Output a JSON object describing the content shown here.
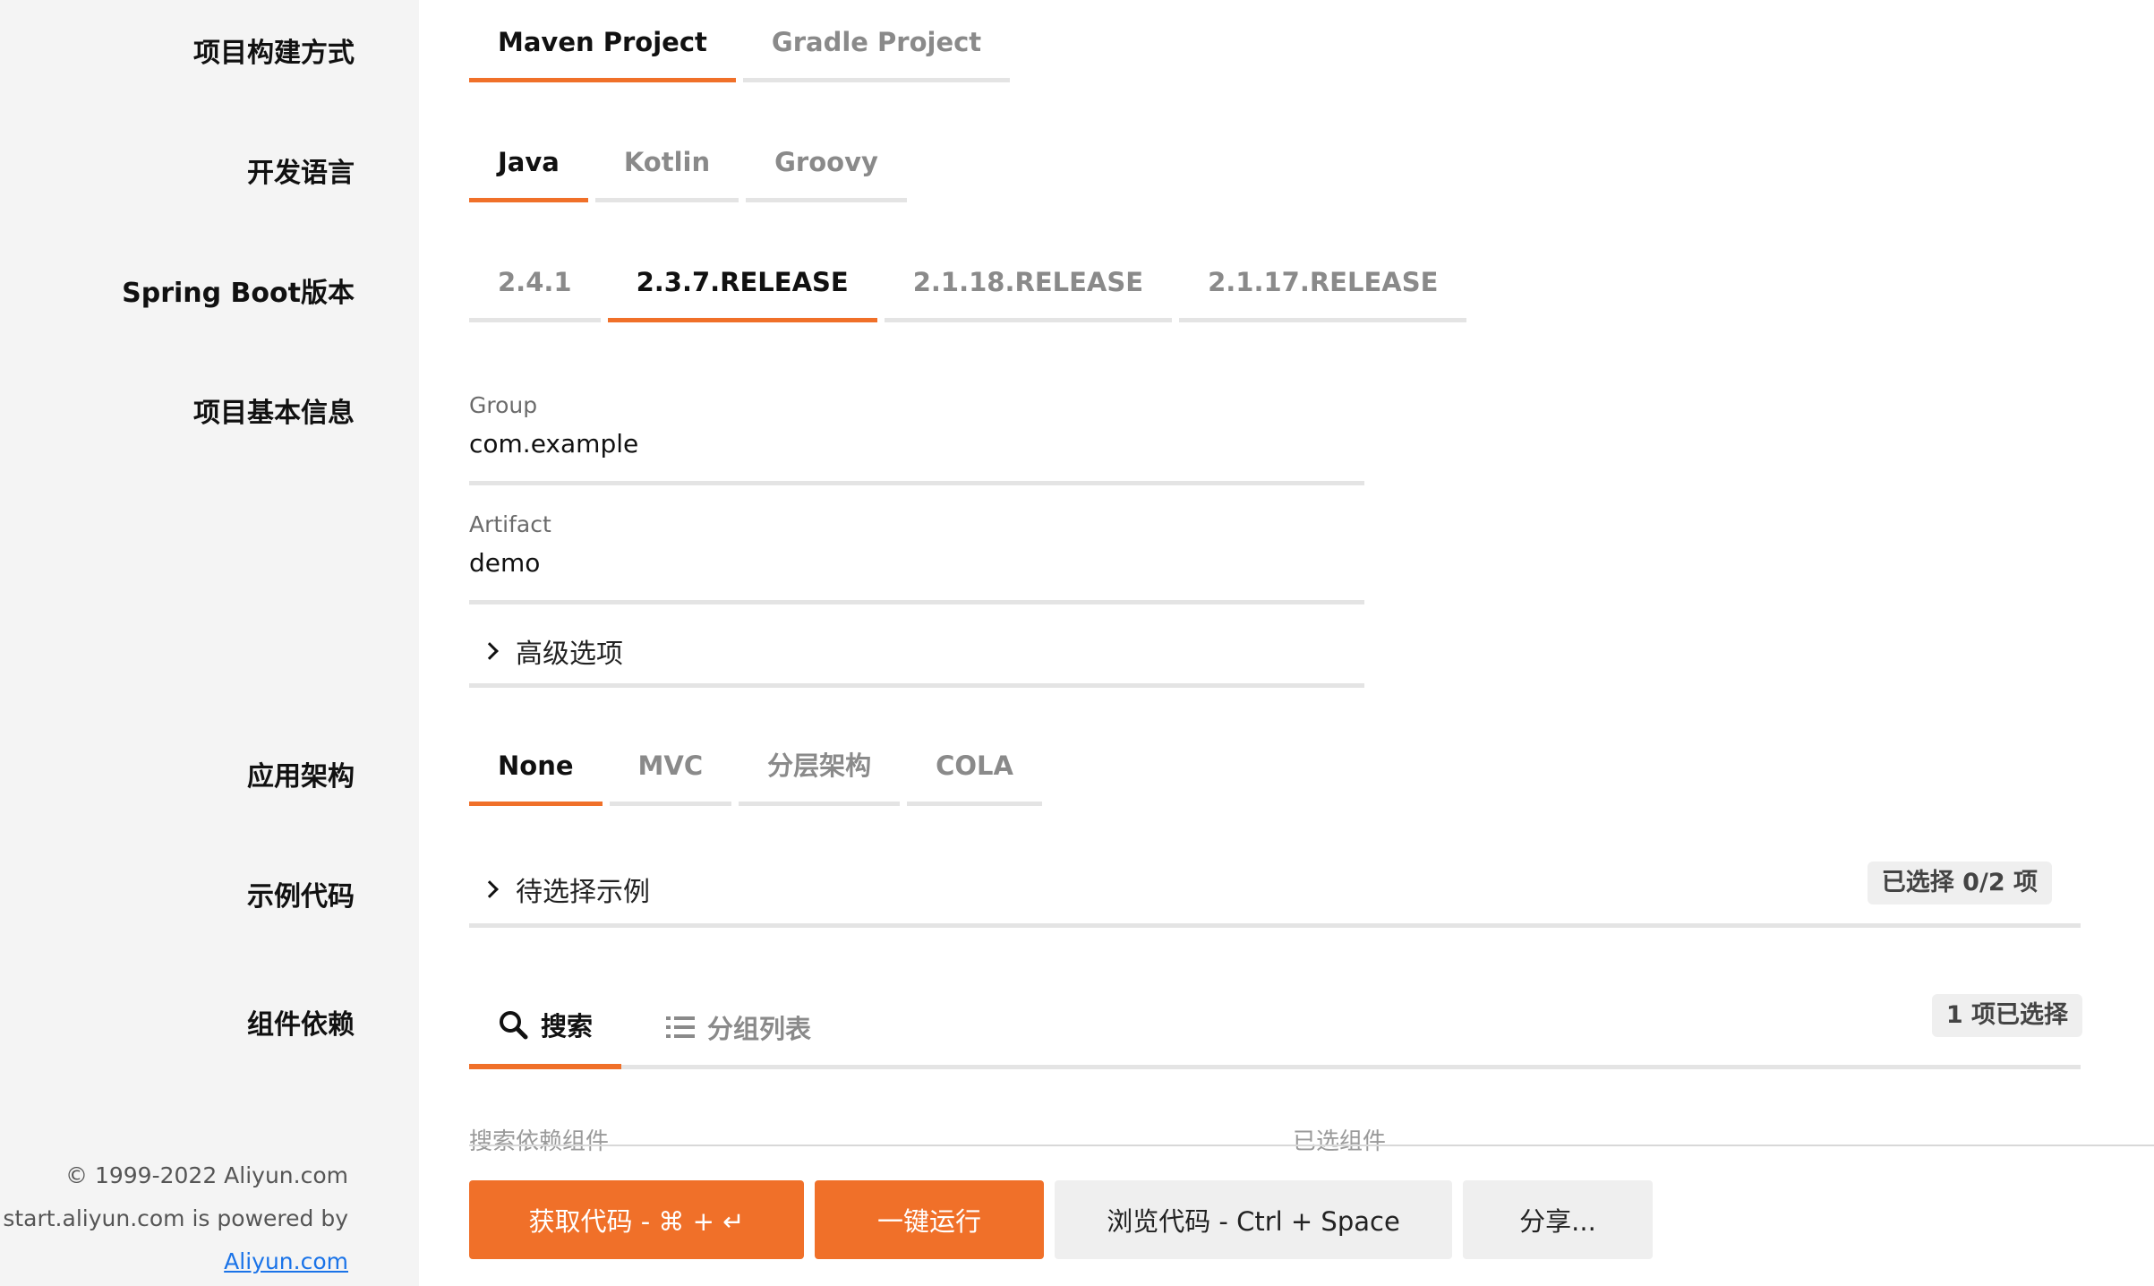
{
  "labels": {
    "build": "项目构建方式",
    "language": "开发语言",
    "boot": "Spring Boot版本",
    "basic": "项目基本信息",
    "arch": "应用架构",
    "examples": "示例代码",
    "deps": "组件依赖"
  },
  "build_tabs": [
    "Maven Project",
    "Gradle Project"
  ],
  "build_selected": "Maven Project",
  "language_tabs": [
    "Java",
    "Kotlin",
    "Groovy"
  ],
  "language_selected": "Java",
  "boot_tabs": [
    "2.4.1",
    "2.3.7.RELEASE",
    "2.1.18.RELEASE",
    "2.1.17.RELEASE"
  ],
  "boot_selected": "2.3.7.RELEASE",
  "basic": {
    "group_label": "Group",
    "group_value": "com.example",
    "artifact_label": "Artifact",
    "artifact_value": "demo",
    "advanced": "高级选项"
  },
  "arch_tabs": [
    "None",
    "MVC",
    "分层架构",
    "COLA"
  ],
  "arch_selected": "None",
  "examples": {
    "expander": "待选择示例",
    "badge": "已选择 0/2 项"
  },
  "deps": {
    "search_tab": "搜索",
    "group_tab": "分组列表",
    "badge": "1 项已选择",
    "search_placeholder": "搜索依赖组件",
    "selected_placeholder": "已选组件"
  },
  "footer": {
    "copyright": "© 1999-2022 Aliyun.com",
    "powered": "start.aliyun.com is powered by",
    "link": "Aliyun.com"
  },
  "buttons": {
    "get_code": "获取代码 - ⌘ + ↵",
    "run": "一键运行",
    "browse": "浏览代码 - Ctrl + Space",
    "share": "分享..."
  },
  "colors": {
    "accent": "#f07029",
    "sidebar": "#f4f4f4",
    "underline": "#e4e4e4"
  }
}
